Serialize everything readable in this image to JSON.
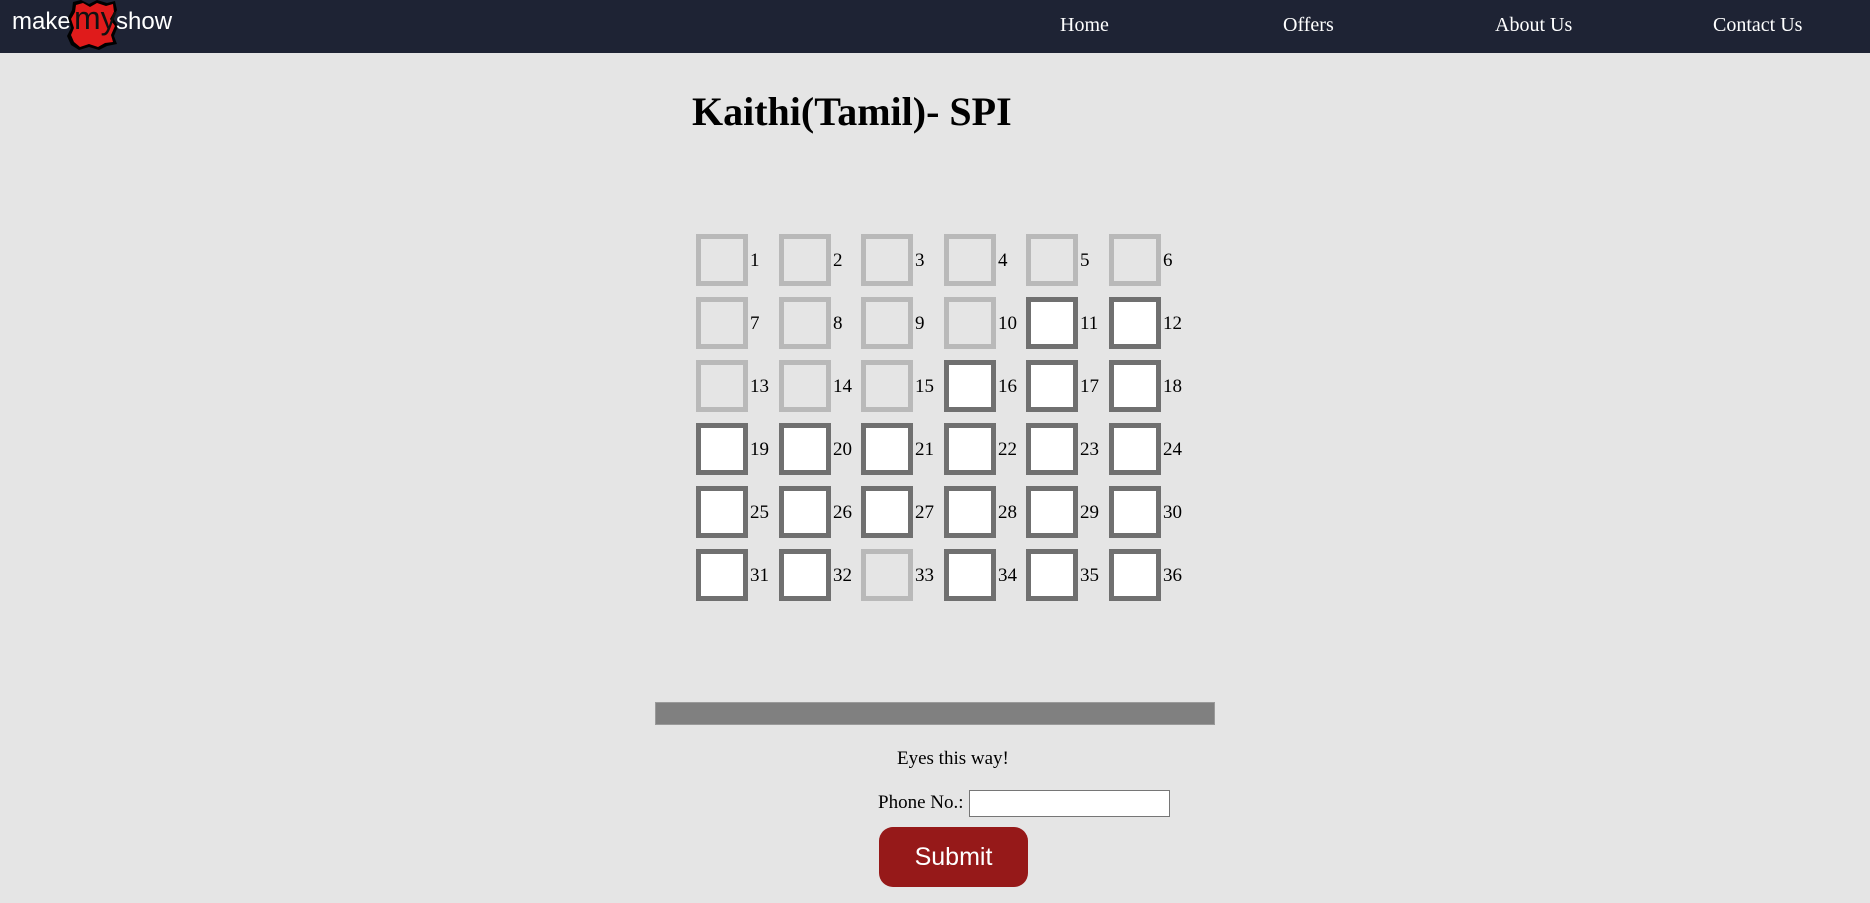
{
  "brand": {
    "make": "make",
    "my": "my",
    "show": "show",
    "accent_color": "#e01b1b"
  },
  "nav": {
    "home": "Home",
    "offers": "Offers",
    "about": "About Us",
    "contact": "Contact Us"
  },
  "movie": {
    "title": "Kaithi(Tamil)- SPI"
  },
  "seats": [
    {
      "number": "1",
      "status": "booked"
    },
    {
      "number": "2",
      "status": "booked"
    },
    {
      "number": "3",
      "status": "booked"
    },
    {
      "number": "4",
      "status": "booked"
    },
    {
      "number": "5",
      "status": "booked"
    },
    {
      "number": "6",
      "status": "booked"
    },
    {
      "number": "7",
      "status": "booked"
    },
    {
      "number": "8",
      "status": "booked"
    },
    {
      "number": "9",
      "status": "booked"
    },
    {
      "number": "10",
      "status": "booked"
    },
    {
      "number": "11",
      "status": "available"
    },
    {
      "number": "12",
      "status": "available"
    },
    {
      "number": "13",
      "status": "booked"
    },
    {
      "number": "14",
      "status": "booked"
    },
    {
      "number": "15",
      "status": "booked"
    },
    {
      "number": "16",
      "status": "available"
    },
    {
      "number": "17",
      "status": "available"
    },
    {
      "number": "18",
      "status": "available"
    },
    {
      "number": "19",
      "status": "available"
    },
    {
      "number": "20",
      "status": "available"
    },
    {
      "number": "21",
      "status": "available"
    },
    {
      "number": "22",
      "status": "available"
    },
    {
      "number": "23",
      "status": "available"
    },
    {
      "number": "24",
      "status": "available"
    },
    {
      "number": "25",
      "status": "available"
    },
    {
      "number": "26",
      "status": "available"
    },
    {
      "number": "27",
      "status": "available"
    },
    {
      "number": "28",
      "status": "available"
    },
    {
      "number": "29",
      "status": "available"
    },
    {
      "number": "30",
      "status": "available"
    },
    {
      "number": "31",
      "status": "available"
    },
    {
      "number": "32",
      "status": "available"
    },
    {
      "number": "33",
      "status": "booked"
    },
    {
      "number": "34",
      "status": "available"
    },
    {
      "number": "35",
      "status": "available"
    },
    {
      "number": "36",
      "status": "available"
    }
  ],
  "screen": {
    "caption": "Eyes this way!"
  },
  "form": {
    "phone_label": "Phone No.:",
    "phone_value": "",
    "submit_label": "Submit"
  }
}
